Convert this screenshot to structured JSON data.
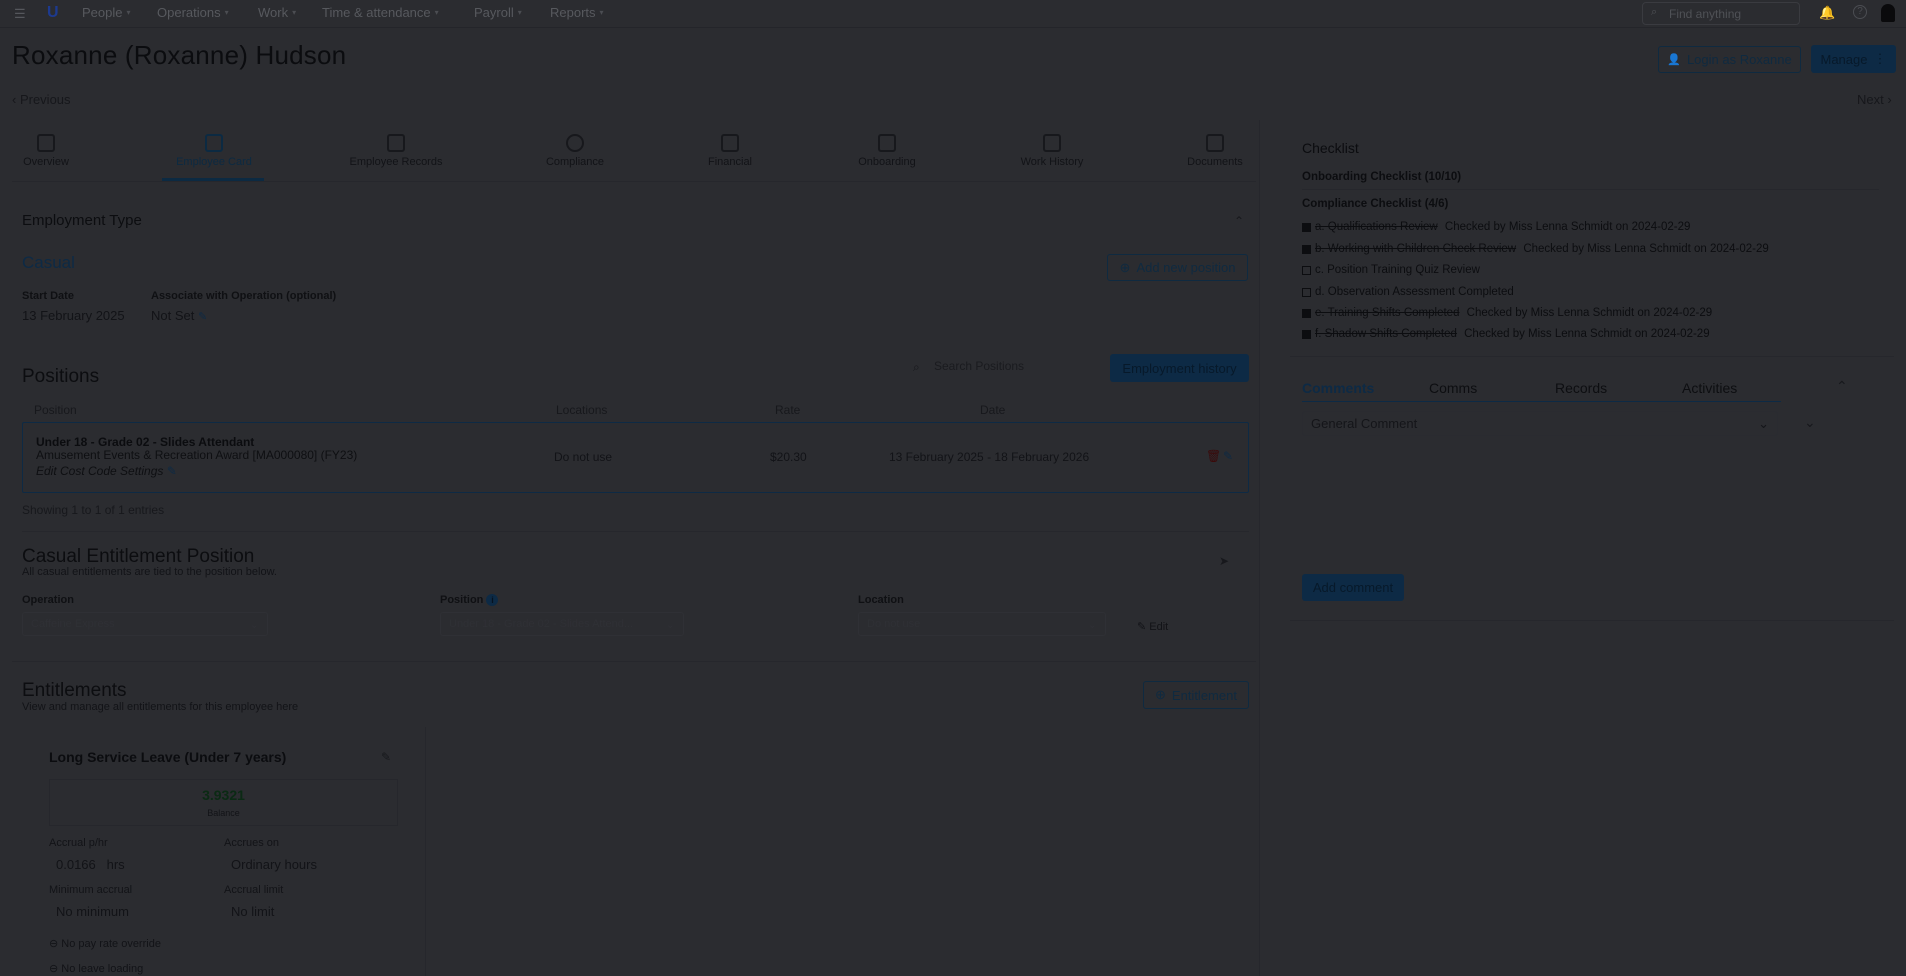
{
  "nav": {
    "items": [
      "People",
      "Operations",
      "Work",
      "Time & attendance",
      "Payroll",
      "Reports"
    ],
    "search_placeholder": "Find anything"
  },
  "page": {
    "title": "Roxanne (Roxanne) Hudson",
    "login_as": "Login as Roxanne",
    "manage": "Manage",
    "previous": "Previous",
    "next": "Next"
  },
  "tabs": [
    "Overview",
    "Employee Card",
    "Employee Records",
    "Compliance",
    "Financial",
    "Onboarding",
    "Work History",
    "Documents"
  ],
  "employment": {
    "section_title": "Employment Type",
    "type": "Casual",
    "add_position": "Add new position",
    "start_date_label": "Start Date",
    "start_date": "13 February 2025",
    "associate_label": "Associate with Operation (optional)",
    "associate_value": "Not Set"
  },
  "positions": {
    "title": "Positions",
    "search_placeholder": "Search Positions",
    "history_button": "Employment history",
    "headers": [
      "Position",
      "Locations",
      "Rate",
      "Date"
    ],
    "row": {
      "name": "Under 18 - Grade 02 - Slides Attendant",
      "award": "Amusement Events & Recreation Award [MA000080] (FY23)",
      "cost_code": "Edit Cost Code Settings",
      "location": "Do not use",
      "rate": "$20.30",
      "date": "13 February 2025 - 18 February 2026"
    },
    "showing": "Showing 1 to 1 of 1 entries"
  },
  "casual_entitlement": {
    "title": "Casual Entitlement Position",
    "subtitle": "All casual entitlements are tied to the position below.",
    "operation_label": "Operation",
    "operation_value": "Caffeine Express",
    "position_label": "Position",
    "position_value": "Under 18 - Grade 02 - Slides Attend...",
    "location_label": "Location",
    "location_value": "Do not use",
    "edit": "Edit"
  },
  "entitlements": {
    "title": "Entitlements",
    "subtitle": "View and manage all entitlements for this employee here",
    "button": "Entitlement",
    "card": {
      "title": "Long Service Leave (Under 7 years)",
      "balance": "3.9321",
      "balance_label": "Balance",
      "accrual_label": "Accrual p/hr",
      "accrual_value": "0.0166",
      "accrual_unit": "hrs",
      "accrues_on_label": "Accrues on",
      "accrues_on_value": "Ordinary hours",
      "min_label": "Minimum accrual",
      "min_value": "No minimum",
      "limit_label": "Accrual limit",
      "limit_value": "No limit",
      "flag1": "No pay rate override",
      "flag2": "No leave loading"
    }
  },
  "checklist": {
    "title": "Checklist",
    "onboarding": "Onboarding Checklist (10/10)",
    "compliance": "Compliance Checklist (4/6)",
    "items": [
      {
        "label": "a. Qualifications Review",
        "checked": true,
        "note": " Checked by Miss Lenna Schmidt on 2024-02-29"
      },
      {
        "label": "b. Working with Children Check Review",
        "checked": true,
        "note": " Checked by Miss Lenna Schmidt on 2024-02-29"
      },
      {
        "label": "c. Position Training Quiz Review",
        "checked": false,
        "note": ""
      },
      {
        "label": "d. Observation Assessment Completed",
        "checked": false,
        "note": ""
      },
      {
        "label": "e. Training Shifts Completed",
        "checked": true,
        "note": " Checked by Miss Lenna Schmidt on 2024-02-29"
      },
      {
        "label": "f. Shadow Shifts Completed",
        "checked": true,
        "note": " Checked by Miss Lenna Schmidt on 2024-02-29"
      }
    ]
  },
  "comments": {
    "tabs": [
      "Comments",
      "Comms",
      "Records",
      "Activities"
    ],
    "type_select": "General Comment",
    "add": "Add comment"
  }
}
